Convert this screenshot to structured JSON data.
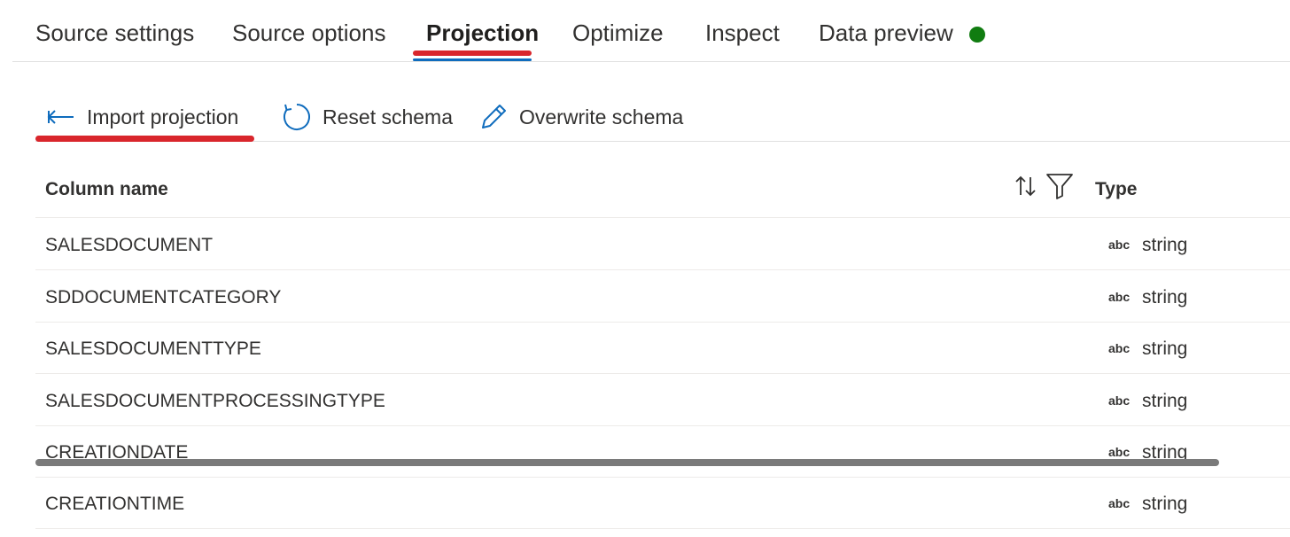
{
  "tabs": [
    {
      "label": "Source settings"
    },
    {
      "label": "Source options"
    },
    {
      "label": "Projection",
      "active": true
    },
    {
      "label": "Optimize"
    },
    {
      "label": "Inspect"
    },
    {
      "label": "Data preview",
      "status": "green-dot"
    }
  ],
  "toolbar": {
    "import_label": "Import projection",
    "reset_label": "Reset schema",
    "overwrite_label": "Overwrite schema"
  },
  "table": {
    "header_name": "Column name",
    "header_type": "Type",
    "rows": [
      {
        "name": "SALESDOCUMENT",
        "type_icon": "abc",
        "type": "string"
      },
      {
        "name": "SDDOCUMENTCATEGORY",
        "type_icon": "abc",
        "type": "string"
      },
      {
        "name": "SALESDOCUMENTTYPE",
        "type_icon": "abc",
        "type": "string"
      },
      {
        "name": "SALESDOCUMENTPROCESSINGTYPE",
        "type_icon": "abc",
        "type": "string"
      },
      {
        "name": "CREATIONDATE",
        "type_icon": "abc",
        "type": "string"
      },
      {
        "name": "CREATIONTIME",
        "type_icon": "abc",
        "type": "string"
      }
    ]
  },
  "colors": {
    "accent": "#0f6cbd",
    "annotation": "#d9262c",
    "status_ok": "#107c10"
  },
  "icons": {
    "import": "arrow-left-icon",
    "reset": "refresh-icon",
    "overwrite": "pencil-icon",
    "sort": "sort-icon",
    "filter": "filter-icon"
  }
}
